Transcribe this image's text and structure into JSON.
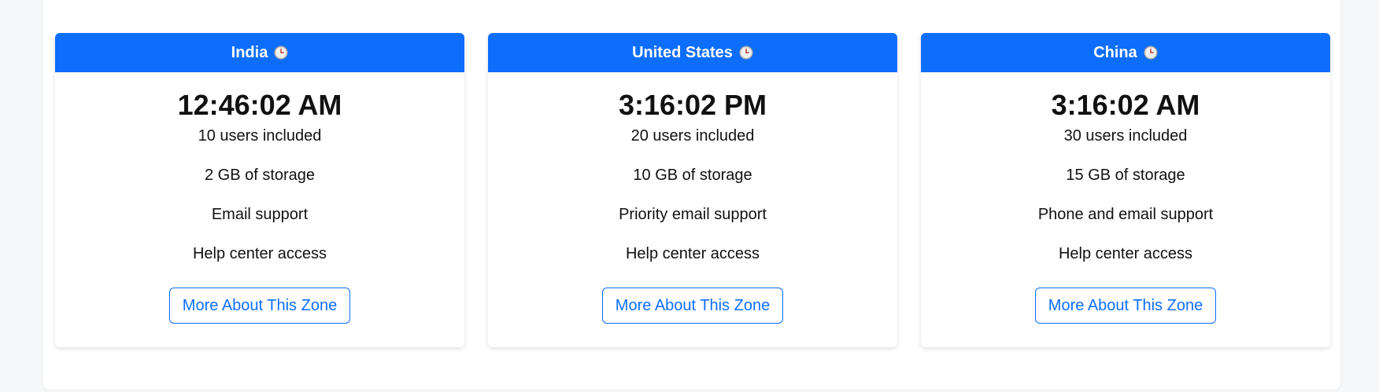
{
  "zones": [
    {
      "name": "India",
      "time": "12:46:02 AM",
      "features": [
        "10 users included",
        "2 GB of storage",
        "Email support",
        "Help center access"
      ],
      "button_label": "More About This Zone"
    },
    {
      "name": "United States",
      "time": "3:16:02 PM",
      "features": [
        "20 users included",
        "10 GB of storage",
        "Priority email support",
        "Help center access"
      ],
      "button_label": "More About This Zone"
    },
    {
      "name": "China",
      "time": "3:16:02 AM",
      "features": [
        "30 users included",
        "15 GB of storage",
        "Phone and email support",
        "Help center access"
      ],
      "button_label": "More About This Zone"
    }
  ],
  "icons": {
    "header_icon": "clock-icon"
  },
  "colors": {
    "header_bg": "#0d6efd",
    "button_border": "#0d6efd",
    "button_text": "#0d6efd"
  }
}
